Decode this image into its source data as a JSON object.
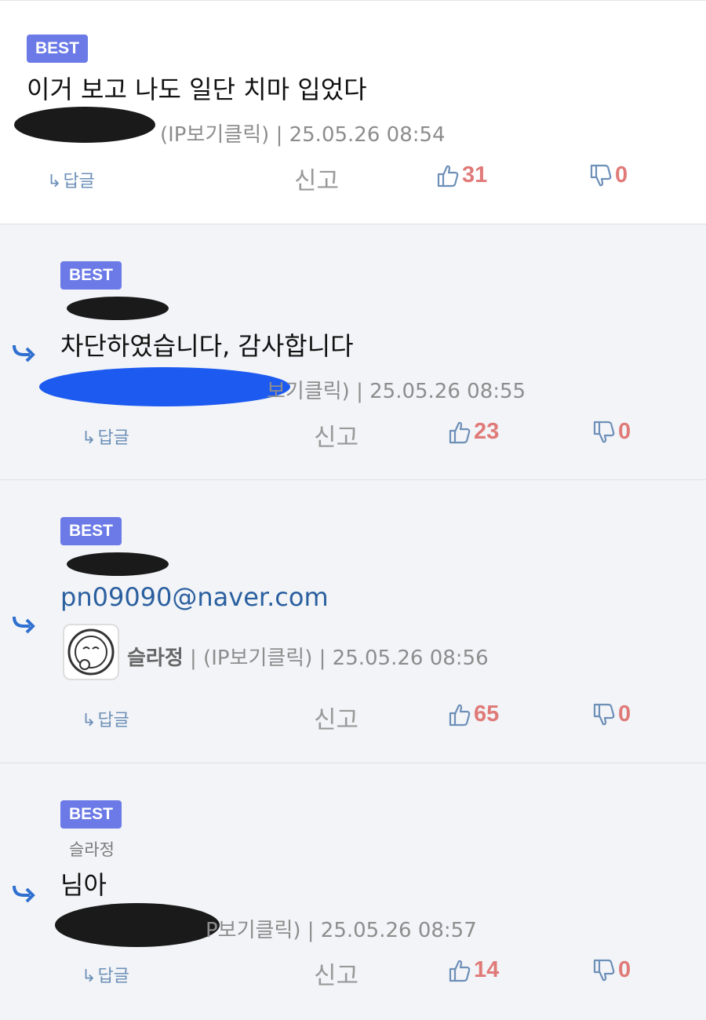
{
  "comments": [
    {
      "badge": "BEST",
      "body": "이거 보고 나도 일단 치마 입었다",
      "meta": "(IP보기클릭) | 25.05.26 08:54",
      "reply_label": "답글",
      "report_label": "신고",
      "likes": "31",
      "dislikes": "0"
    },
    {
      "badge": "BEST",
      "body": "차단하였습니다, 감사합니다",
      "meta": "보기클릭) | 25.05.26 08:55",
      "reply_label": "답글",
      "report_label": "신고",
      "likes": "23",
      "dislikes": "0"
    },
    {
      "badge": "BEST",
      "body": "pn09090@naver.com",
      "author": "슬라정",
      "meta": "| (IP보기클릭) | 25.05.26 08:56",
      "reply_label": "답글",
      "report_label": "신고",
      "likes": "65",
      "dislikes": "0"
    },
    {
      "badge": "BEST",
      "parent": "슬라정",
      "body": "님아",
      "meta": "P보기클릭) | 25.05.26 08:57",
      "reply_label": "답글",
      "report_label": "신고",
      "likes": "14",
      "dislikes": "0"
    }
  ],
  "colors": {
    "badge": "#6b7ae6",
    "vote": "#e07a78",
    "link": "#2a5f9f",
    "reply_arrow": "#2f6fd0"
  },
  "icons": {
    "reply_arrow": "reply-arrow-icon",
    "thumbs_up": "thumbs-up-icon",
    "thumbs_down": "thumbs-down-icon"
  }
}
